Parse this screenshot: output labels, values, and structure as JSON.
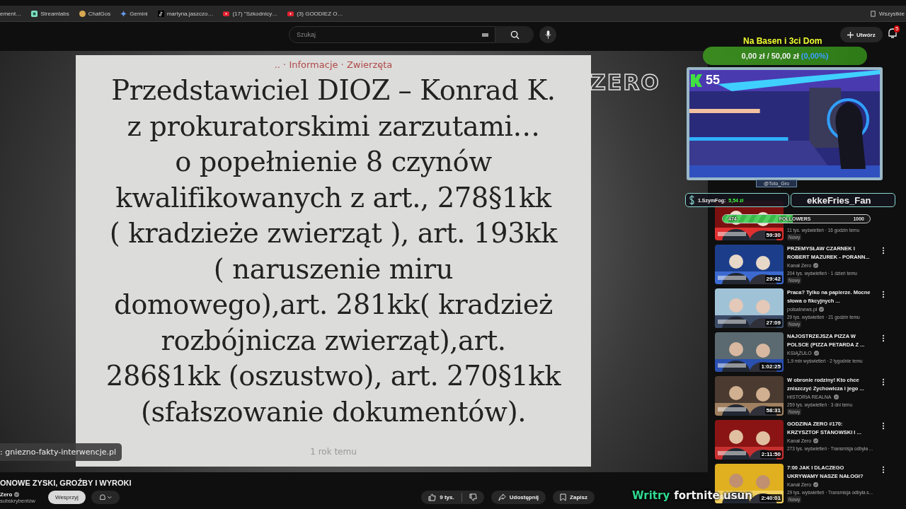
{
  "bookmarks": [
    {
      "kind": "page",
      "label": "ement…"
    },
    {
      "kind": "streamlabs",
      "label": "Streamlabs"
    },
    {
      "kind": "chatgos",
      "label": "ChatGos"
    },
    {
      "kind": "gemini",
      "label": "Gemini"
    },
    {
      "kind": "tiktok",
      "label": "martyna.jaszczo…"
    },
    {
      "kind": "youtube",
      "label": "(17) \"Szkodnicy…"
    },
    {
      "kind": "youtube",
      "label": "(3) GOODIEZ O…"
    }
  ],
  "all_bookmarks": "Wszystkie",
  "search": {
    "placeholder": "Szukaj"
  },
  "create_button": "Utwórz",
  "notifications": "5",
  "slide": {
    "breadcrumb": ".. · Informacje · Zwierzęta",
    "lines": [
      "Przedstawiciel DIOZ – Konrad K.",
      "z prokuratorskimi zarzutami…",
      "o popełnienie 8 czynów",
      "kwalifikowanych z art., 278§1kk",
      "( kradzieże zwierząt ), art. 193kk",
      "( naruszenie miru",
      "domowego),art. 281kk( kradzież",
      "rozbójnicza zwierząt),art.",
      "286§1kk (oszustwo), art. 270§1kk",
      "(sfałszowanie dokumentów)."
    ],
    "date": "1 rok temu"
  },
  "link_bubble": ": gniezno-fakty-interwencje.pl",
  "video_title": "ONOWE ZYSKI, GROŹBY I WYROKI",
  "channel": {
    "name": "Zero",
    "verified": true,
    "subscribers": "subskrybentów"
  },
  "support_button": "Wesprzyj",
  "actions": {
    "likes": "9 tys.",
    "share": "Udostępnij",
    "save": "Zapisz"
  },
  "sidebar": [
    {
      "views": "11 tys. wyświetleń · 16 godzin temu",
      "badge": "Nowy",
      "duration": "59:30"
    },
    {
      "title": "PRZEMYSŁAW CZARNEK I ROBERT MAZUREK - PORANN...",
      "channel": "Kanał Zero",
      "verified": true,
      "views": "204 tys. wyświetleń · 1 dzień temu",
      "badge": "Nowy",
      "duration": "29:42"
    },
    {
      "title": "Praca? Tylko na papierze. Mocne słowa o fikcyjnych ...",
      "channel": "polsatnews.pl",
      "verified": true,
      "views": "29 tys. wyświetleń · 21 godzin temu",
      "badge": "Nowy",
      "duration": "27:09"
    },
    {
      "title": "NAJOSTRZEJSZA PIZZA W POLSCE (PIZZA PETARDA Z ...",
      "channel": "KSIĄŻULO",
      "verified": true,
      "views": "1,9 mln wyświetleń · 2 tygodnie temu",
      "duration": "1:02:25"
    },
    {
      "title": "W obronie rodziny! Kto chce zniszczyć Zychowicza i jego ...",
      "channel": "HISTORIA REALNA",
      "verified": true,
      "views": "259 tys. wyświetleń · 3 dni temu",
      "badge": "Nowy",
      "duration": "58:31"
    },
    {
      "title": "GODZINA ZERO #170: KRZYSZTOF STANOWSKI I ...",
      "channel": "Kanał Zero",
      "verified": true,
      "views": "273 tys. wyświetleń · Transmisja odbyła ...",
      "duration": "2:11:50"
    },
    {
      "title": "7:00 JAK I DLACZEGO UKRYWAMY NASZE NAŁOGI?",
      "channel": "Kanał Zero",
      "verified": true,
      "views": "29 tys. wyświetleń · Transmisja odbyła s...",
      "badge": "Nowy",
      "duration": "2:40:01"
    }
  ],
  "overlay": {
    "logo": "ZERO",
    "goal": {
      "title": "Na Basen i 3ci Dom",
      "current": "0,00 zł",
      "separator": "/",
      "target": "50,00 zł",
      "percent": "(0,00%)"
    },
    "viewers": "55",
    "handle": "@Toto_Gro",
    "top_donor": {
      "name": "1.SzymFog:",
      "amount": "5,54 zł"
    },
    "latest_follower": "ekkeFries_Fan",
    "followers": {
      "current": "474",
      "label": "FOLLOWERS",
      "target": "1000",
      "level": 0.474
    },
    "caption": {
      "highlight": "Writry",
      "text": "fortnite usun"
    }
  }
}
